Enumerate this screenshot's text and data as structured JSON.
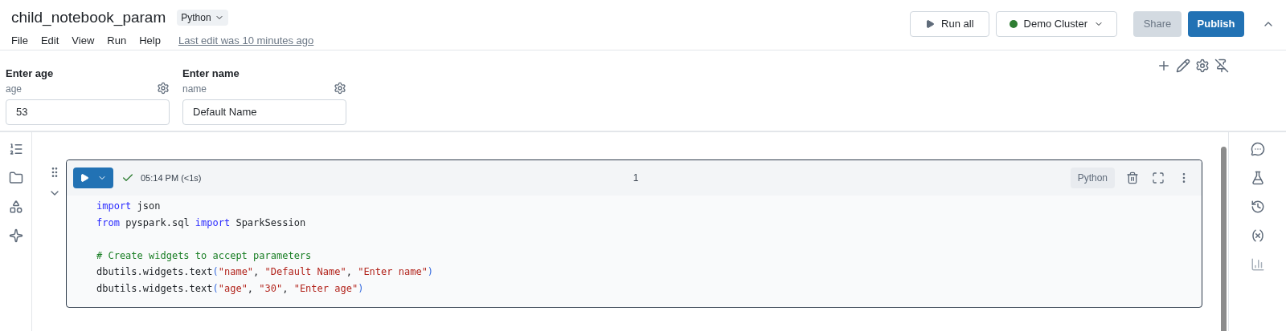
{
  "notebook": {
    "title": "child_notebook_param",
    "language": "Python"
  },
  "menu": [
    "File",
    "Edit",
    "View",
    "Run",
    "Help"
  ],
  "last_edit": "Last edit was 10 minutes ago",
  "toolbar": {
    "run_all": "Run all",
    "cluster": {
      "name": "Demo Cluster",
      "color": "#2e7d32"
    },
    "share": {
      "label": "Share",
      "disabled": true
    },
    "publish": {
      "label": "Publish",
      "disabled": false
    }
  },
  "widgets": [
    {
      "label": "Enter age",
      "name": "age",
      "value": "53"
    },
    {
      "label": "Enter name",
      "name": "name",
      "value": "Default Name"
    }
  ],
  "cell": {
    "status": "05:14 PM (<1s)",
    "number": "1",
    "language": "Python",
    "lines": [
      {
        "tokens": [
          {
            "kind": "keyword",
            "text": "import"
          },
          {
            "kind": "plain",
            "text": " json"
          }
        ]
      },
      {
        "tokens": [
          {
            "kind": "keyword",
            "text": "from"
          },
          {
            "kind": "plain",
            "text": " pyspark.sql "
          },
          {
            "kind": "keyword",
            "text": "import"
          },
          {
            "kind": "plain",
            "text": " SparkSession"
          }
        ]
      },
      {
        "blank_before": true,
        "tokens": [
          {
            "kind": "comment",
            "text": "# Create widgets to accept parameters"
          }
        ]
      },
      {
        "tokens": [
          {
            "kind": "plain",
            "text": "dbutils.widgets.text"
          },
          {
            "kind": "punct",
            "text": "("
          },
          {
            "kind": "string",
            "text": "\"name\""
          },
          {
            "kind": "plain",
            "text": ", "
          },
          {
            "kind": "string",
            "text": "\"Default Name\""
          },
          {
            "kind": "plain",
            "text": ", "
          },
          {
            "kind": "string",
            "text": "\"Enter name\""
          },
          {
            "kind": "punct",
            "text": ")"
          }
        ]
      },
      {
        "tokens": [
          {
            "kind": "plain",
            "text": "dbutils.widgets.text"
          },
          {
            "kind": "punct",
            "text": "("
          },
          {
            "kind": "string",
            "text": "\"age\""
          },
          {
            "kind": "plain",
            "text": ", "
          },
          {
            "kind": "string",
            "text": "\"30\""
          },
          {
            "kind": "plain",
            "text": ", "
          },
          {
            "kind": "string",
            "text": "\"Enter age\""
          },
          {
            "kind": "punct",
            "text": ")"
          }
        ]
      }
    ]
  }
}
